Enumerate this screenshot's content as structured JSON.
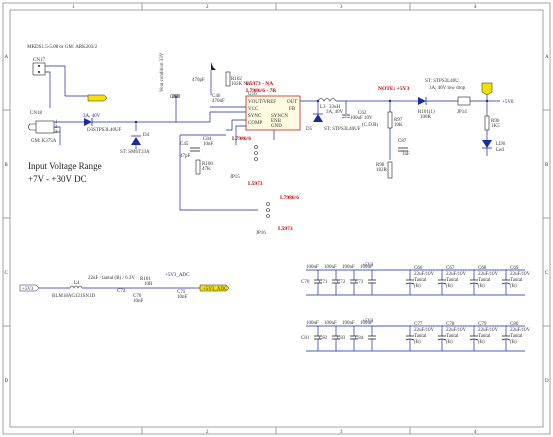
{
  "frame": {
    "cols": [
      "1",
      "2",
      "3",
      "4"
    ],
    "rows": [
      "A",
      "B",
      "C",
      "D"
    ]
  },
  "connectors": {
    "cn17_part": "MKDS1.5-5.08 or GM: ARK203/2",
    "cn17_ref": "CN17",
    "cn18_ref": "CN18",
    "cn18_part": "GM: K375A"
  },
  "input": {
    "d3_ref": "D3",
    "d3_part": "STPS3L40UF",
    "d3_rating": "3A, 40V",
    "d4_ref": "D4",
    "d4_part": "ST: SM6T33A",
    "note_text": "Input Voltage Range",
    "range_text": "+7V - +30V DC"
  },
  "reg": {
    "c43_ref": "C43",
    "c43_note": "Vout condition 33V",
    "c46_ref": "C46",
    "c46_val": "470nF",
    "c46_side_val": "470pF",
    "r102_ref": "R102",
    "r102_val": "102K NA",
    "u16_ref": "U16",
    "u16_pins": [
      "VOUT/VREF",
      "VCC",
      "SYNC",
      "COMP"
    ],
    "u16_pins_r": [
      "OUT",
      "FB"
    ],
    "u16_pins_b": [
      "SYNCN",
      "ENB",
      "GND"
    ],
    "title_1": "L5973 - NA",
    "title_2": "L7986/6 - 7R",
    "l3_ref": "L3",
    "l3_val": "33uH",
    "d5_ref": "D5",
    "d5_rating": "3A, 40V",
    "d5_part": "ST: STPS3L40UF",
    "c62_ref": "C62",
    "c62_val": "100uF 10V",
    "c62_note": "(C.D.R)",
    "r97_ref": "R97",
    "r97_val": "10K",
    "c87_ref": "C87",
    "c87_val": "1nF",
    "r98_ref": "R98",
    "r98_val": "182R",
    "c45_ref": "C45",
    "c45_val": "47pF",
    "c84_ref": "C84",
    "c84_val": "10nF",
    "r100_ref": "R100",
    "r100_val": "47K",
    "sel1_label": "L7986/6",
    "jp15_ref": "JP15",
    "jp15_label": "L5973",
    "sel2_label": "L7986/6",
    "jp16_ref": "JP16",
    "jp16_label": "L5973"
  },
  "output": {
    "note": "NOTE: +5V3",
    "d7_part": "ST: STPS3L40U",
    "d7_rating": "3A, 40V low drop",
    "r101_ref": "R101(1)",
    "r101_val": "100R",
    "jp14_ref": "JP14",
    "net_label": "+5V0",
    "r96_ref": "R96",
    "r96_val": "1K5",
    "ld6_ref": "LD6",
    "ld6_label": "Led"
  },
  "filter": {
    "in_net": "+5V3",
    "l4_ref": "L4",
    "l4_part": "BLM18AG121SN1D",
    "l4_val": "22uF / tantal (B) / 6.3V",
    "c74_ref": "C74",
    "r101b_ref": "R101",
    "r101b_val": "10R",
    "c76_ref": "C76",
    "c76_val": "10nF",
    "c75_ref": "C75",
    "c75_val": "10nF",
    "net_adc": "+5V3_ADC",
    "net_adc_tag": "+5V3_ADC"
  },
  "decoupling": {
    "net": "+5V3",
    "ceram_val": "100nF",
    "tant_val": "22uF/10V",
    "tant_sub": "Tantal",
    "tant_pkg": "(B)",
    "row1_ceram": [
      "C70",
      "C71",
      "C72",
      "C73"
    ],
    "row1_tant": [
      "C66",
      "C67",
      "C68",
      "C69"
    ],
    "row2_ceram": [
      "C81",
      "C82",
      "C83",
      "C84"
    ],
    "row2_tant": [
      "C77",
      "C78",
      "C79",
      "C80"
    ]
  },
  "colors": {
    "wire": "#1a2aa0",
    "component": "#222222",
    "title_red": "#c00000",
    "net_flag": "#f5e000"
  }
}
